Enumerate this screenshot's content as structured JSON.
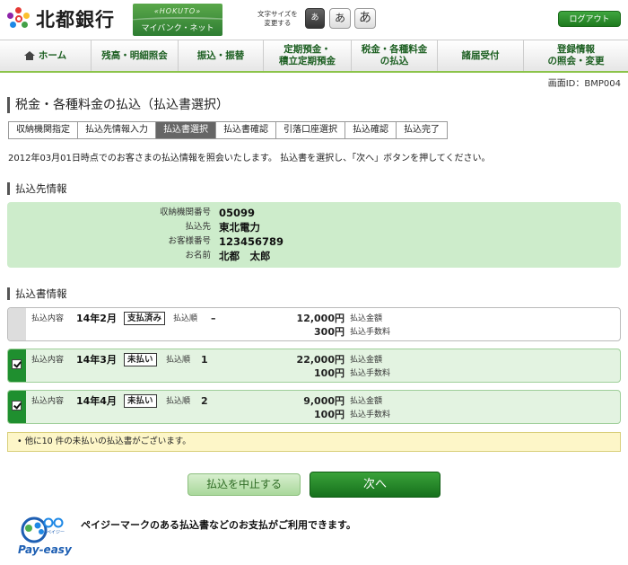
{
  "header": {
    "logo_text": "北都銀行",
    "banner_top": "«HOKUTO»",
    "banner_bottom": "マイバンク・ネット",
    "fontsize_label_1": "文字サイズを",
    "fontsize_label_2": "変更する",
    "fontsize_options": [
      "あ",
      "あ",
      "あ"
    ],
    "logout_label": "ログアウト"
  },
  "nav": {
    "items": [
      {
        "label": "ホーム"
      },
      {
        "label": "残高・明細照会"
      },
      {
        "label": "振込・振替"
      },
      {
        "label_1": "定期預金・",
        "label_2": "積立定期預金"
      },
      {
        "label_1": "税金・各種料金",
        "label_2": "の払込"
      },
      {
        "label": "諸届受付"
      },
      {
        "label_1": "登録情報",
        "label_2": "の照会・変更"
      }
    ]
  },
  "screen_id": "画面ID：BMP004",
  "page_title": "税金・各種料金の払込（払込書選択）",
  "steps": [
    "収納機関指定",
    "払込先情報入力",
    "払込書選択",
    "払込書確認",
    "引落口座選択",
    "払込確認",
    "払込完了"
  ],
  "intro": "2012年03月01日時点でのお客さまの払込情報を照会いたします。 払込書を選択し、「次へ」ボタンを押してください。",
  "payee": {
    "section_title": "払込先情報",
    "rows": [
      {
        "label": "収納機関番号",
        "value": "05099"
      },
      {
        "label": "払込先",
        "value": "東北電力"
      },
      {
        "label": "お客様番号",
        "value": "123456789"
      },
      {
        "label": "お名前",
        "value": "北都　太郎"
      }
    ]
  },
  "bills": {
    "section_title": "払込書情報",
    "content_label": "払込内容",
    "order_label": "払込順",
    "amount_label": "払込金額",
    "fee_label": "払込手数料",
    "items": [
      {
        "month": "14年2月",
        "status": "支払済み",
        "order": "–",
        "amount": "12,000円",
        "fee": "300円"
      },
      {
        "month": "14年3月",
        "status": "未払い",
        "order": "1",
        "amount": "22,000円",
        "fee": "100円"
      },
      {
        "month": "14年4月",
        "status": "未払い",
        "order": "2",
        "amount": "9,000円",
        "fee": "100円"
      }
    ]
  },
  "notice": "• 他に10 件の未払いの払込書がございます。",
  "buttons": {
    "cancel": "払込を中止する",
    "next": "次へ"
  },
  "payeasy": {
    "logo_text": "Pay-easy",
    "logo_small": "ペイジー",
    "message": "ペイジーマークのある払込書などのお支払がご利用できます。"
  },
  "colors": {
    "brand_green": "#1f8f2f",
    "payee_bg": "#cdeccb",
    "notice_bg": "#fdf6c8"
  }
}
